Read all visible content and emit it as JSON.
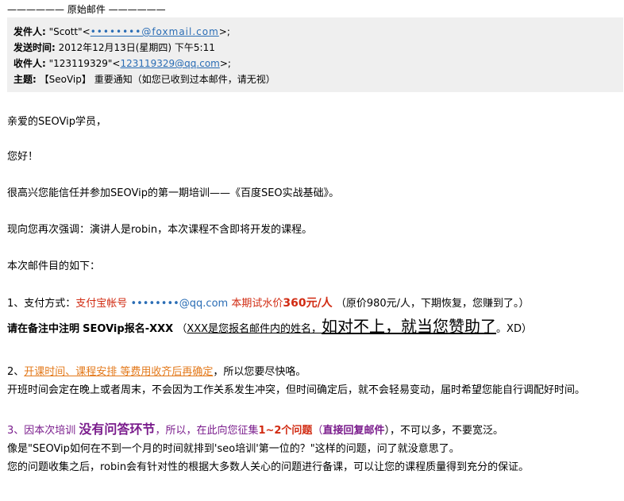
{
  "header": {
    "orig_line": "—————— 原始邮件 ——————",
    "from_label": "发件人:",
    "from_name": "\"Scott\"<",
    "from_email": "••••••••@foxmail.com",
    "from_end": ">;",
    "sent_label": "发送时间:",
    "sent_value": "2012年12月13日(星期四) 下午5:11",
    "to_label": "收件人:",
    "to_name": "\"123119329\"<",
    "to_email": "123119329@qq.com",
    "to_end": ">;",
    "subject_label": "主题:",
    "subject_value": "【SeoVip】 重要通知（如您已收到过本邮件，请无视）"
  },
  "body": {
    "greeting": "亲爱的SEOVip学员，",
    "hello": "您好！",
    "intro": "很高兴您能信任并参加SEOVip的第一期培训——《百度SEO实战基础》。",
    "emphasis": "现向您再次强调：演讲人是robin，本次课程不含即将开发的课程。",
    "purpose": "本次邮件目的如下：",
    "item1": {
      "prefix": "1、支付方式：",
      "alipay_label": "支付宝帐号",
      "alipay_account": "••••••••@qq.com",
      "price_label": "本期试水价",
      "price_value": "360元/人",
      "note": "（原价980元/人，下期恢复，您赚到了。）"
    },
    "remark": {
      "part1": "请在备注中注明",
      "part2": "SEOVip报名-XXX",
      "part3": "（",
      "part4": "XXX是您报名邮件内的姓名，",
      "part5": "如对不上，就当您赞助了",
      "part6": "。XD）"
    },
    "item2": {
      "prefix": "2、",
      "highlight": "开课时间、课程安排 等费用收齐后再确定",
      "rest": "，所以您要尽快咯。",
      "detail": "开班时间会定在晚上或者周末，不会因为工作关系发生冲突，但时间确定后，就不会轻易变动，届时希望您能自行调配好时间。"
    },
    "item3": {
      "prefix": "3、因本次培训",
      "bold_big": "没有问答环节",
      "mid": "，所以，在此向您征集",
      "count": "1~2个问题",
      "paren_open": "（",
      "reply": "直接回复邮件",
      "rest": "），不可以多，不要宽泛。",
      "example": "像是\"SEOVip如何在不到一个月的时间就排到'seo培训'第一位的？\"这样的问题，问了就没意思了。",
      "after": "您的问题收集之后，robin会有针对性的根据大多数人关心的问题进行备课，可以让您的课程质量得到充分的保证。"
    }
  }
}
